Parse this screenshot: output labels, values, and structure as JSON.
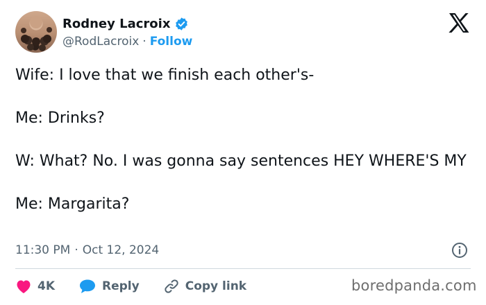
{
  "author": {
    "display_name": "Rodney Lacroix",
    "handle": "@RodLacroix",
    "separator": "·",
    "follow_label": "Follow",
    "verified": true
  },
  "icons": {
    "platform_logo": "x-logo-icon",
    "verified": "verified-badge-icon",
    "info": "info-icon",
    "like": "heart-icon",
    "reply": "reply-bubble-icon",
    "copy_link": "link-icon"
  },
  "colors": {
    "accent": "#1d9bf0",
    "like": "#f91880",
    "secondary_text": "#536471"
  },
  "tweet": {
    "paragraphs": [
      "Wife: I love that we finish each other's-",
      "Me: Drinks?",
      "W: What? No. I was gonna say sentences HEY WHERE'S MY",
      "Me: Margarita?"
    ],
    "time": "11:30 PM",
    "separator": "·",
    "date": "Oct 12, 2024"
  },
  "actions": {
    "like_count": "4K",
    "reply_label": "Reply",
    "copy_link_label": "Copy link"
  },
  "watermark": "boredpanda.com"
}
